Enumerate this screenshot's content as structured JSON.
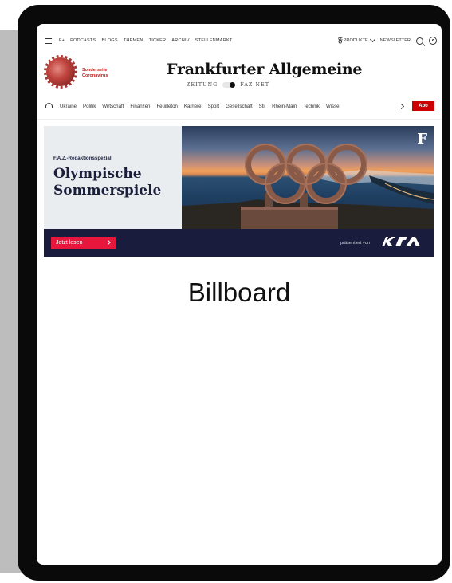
{
  "top_nav": {
    "links": [
      "F+",
      "PODCASTS",
      "BLOGS",
      "THEMEN",
      "TICKER",
      "ARCHIV",
      "STELLENMARKT"
    ],
    "produkte_label": "PRODUKTE",
    "newsletter_label": "NEWSLETTER"
  },
  "special": {
    "line1": "Sonderseite:",
    "line2": "Coronavirus"
  },
  "masthead": {
    "title": "Frankfurter Allgemeine",
    "left_toggle": "ZEITUNG",
    "right_toggle": "FAZ.NET"
  },
  "categories": [
    "Ukraine",
    "Politik",
    "Wirtschaft",
    "Finanzen",
    "Feuilleton",
    "Karriere",
    "Sport",
    "Gesellschaft",
    "Stil",
    "Rhein-Main",
    "Technik",
    "Wisse"
  ],
  "abo_label": "Abo",
  "banner": {
    "kicker": "F.A.Z.-Redaktionsspezial",
    "title_line1": "Olympische",
    "title_line2": "Sommerspiele",
    "button_label": "Jetzt lesen",
    "presented_by": "präsentiert von",
    "sponsor": "KIA",
    "brand_mark": "F"
  },
  "billboard_label": "Billboard",
  "colors": {
    "accent_red": "#c00000",
    "button_red": "#e6163c",
    "navy": "#1a1c3d"
  }
}
